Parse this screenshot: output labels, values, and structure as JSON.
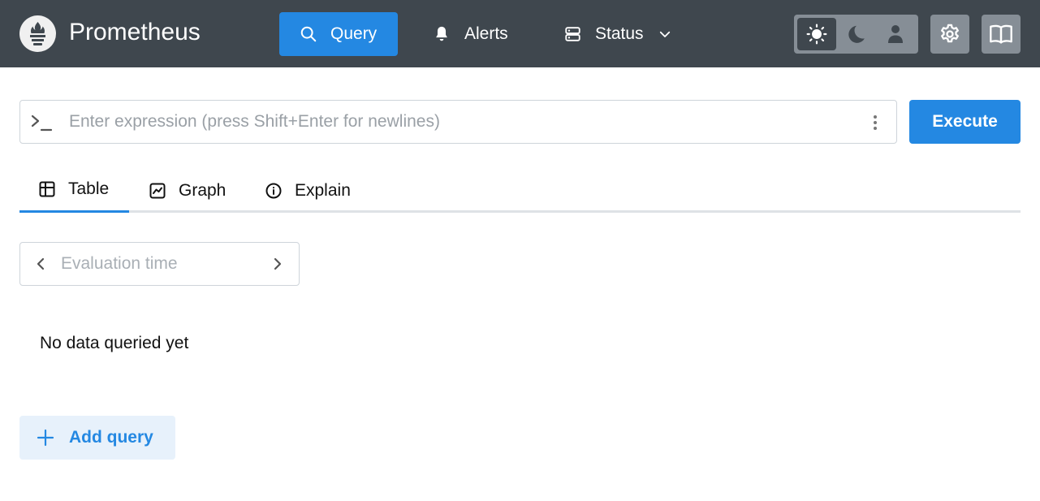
{
  "header": {
    "brand": "Prometheus",
    "logo_icon": "prometheus-flame-icon",
    "nav": {
      "query": {
        "label": "Query",
        "icon": "search-icon",
        "active": true
      },
      "alerts": {
        "label": "Alerts",
        "icon": "bell-icon"
      },
      "status": {
        "label": "Status",
        "icon": "server-icon",
        "dropdown_icon": "chevron-down-icon"
      }
    },
    "theme": {
      "options": [
        "light",
        "dark",
        "auto"
      ],
      "selected": "light",
      "icons": [
        "sun-icon",
        "moon-icon",
        "user-icon"
      ]
    },
    "settings_icon": "gear-icon",
    "docs_icon": "book-icon"
  },
  "expression": {
    "placeholder": "Enter expression (press Shift+Enter for newlines)",
    "value": "",
    "prompt_icon": "terminal-prompt-icon",
    "menu_icon": "dots-vertical-icon"
  },
  "execute": {
    "label": "Execute"
  },
  "tabs": [
    {
      "label": "Table",
      "icon": "table-icon",
      "active": true
    },
    {
      "label": "Graph",
      "icon": "chart-icon",
      "active": false
    },
    {
      "label": "Explain",
      "icon": "info-circle-icon",
      "active": false
    }
  ],
  "evaluation": {
    "placeholder": "Evaluation time",
    "value": "",
    "prev_icon": "chevron-left-icon",
    "next_icon": "chevron-right-icon"
  },
  "results": {
    "empty_text": "No data queried yet"
  },
  "add_query": {
    "label": "Add query",
    "icon": "plus-icon"
  },
  "colors": {
    "header_bg": "#3f474e",
    "accent": "#2488e2",
    "theme_group_bg": "#868e96",
    "add_query_bg": "#e7f1fb"
  }
}
